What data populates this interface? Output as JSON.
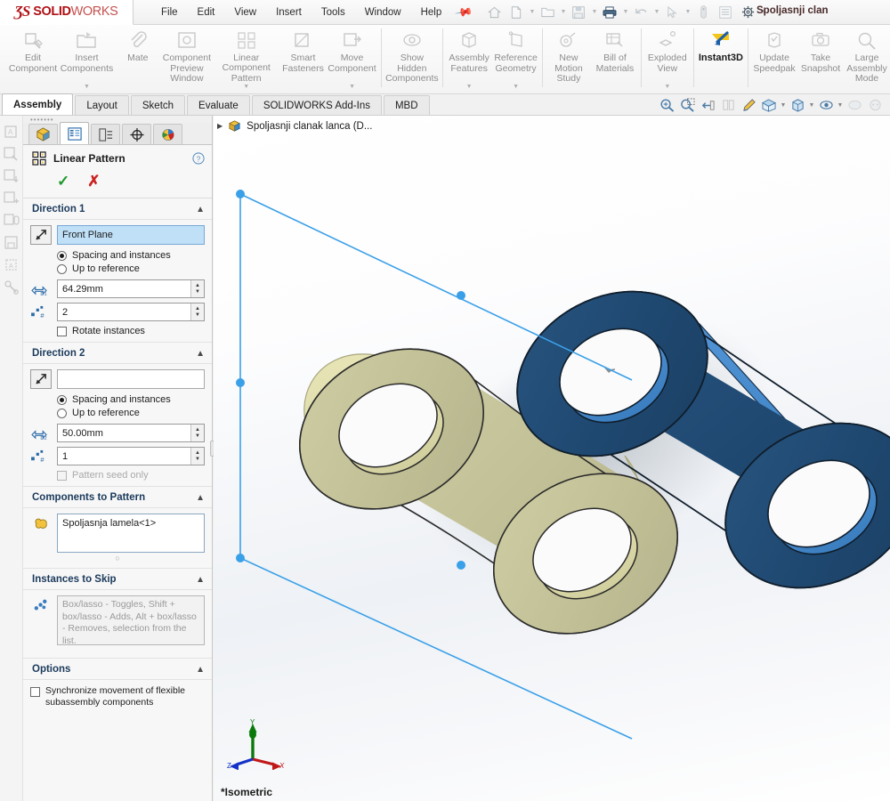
{
  "app": {
    "brand_ds": "ƷS",
    "brand_solid": "SOLID",
    "brand_works": "WORKS",
    "document_title": "Spoljasnji clan",
    "accent_blue": "#2878c8",
    "brand_red": "#b01116"
  },
  "menubar": {
    "items": [
      {
        "label": "File",
        "name": "menu-file"
      },
      {
        "label": "Edit",
        "name": "menu-edit"
      },
      {
        "label": "View",
        "name": "menu-view"
      },
      {
        "label": "Insert",
        "name": "menu-insert"
      },
      {
        "label": "Tools",
        "name": "menu-tools"
      },
      {
        "label": "Window",
        "name": "menu-window"
      },
      {
        "label": "Help",
        "name": "menu-help"
      }
    ],
    "pin_icon": "pushpin-icon"
  },
  "quick_access": {
    "items": [
      {
        "icon": "home-icon",
        "caret": false,
        "active": false
      },
      {
        "icon": "new-file-icon",
        "caret": true,
        "active": false
      },
      {
        "icon": "open-folder-icon",
        "caret": true,
        "active": false
      },
      {
        "icon": "save-icon",
        "caret": true,
        "active": false
      },
      {
        "icon": "print-icon",
        "caret": true,
        "active": true
      },
      {
        "icon": "undo-icon",
        "caret": true,
        "active": false
      },
      {
        "icon": "select-cursor-icon",
        "caret": true,
        "active": false
      },
      {
        "icon": "rebuild-icon",
        "caret": false,
        "active": false
      },
      {
        "icon": "options-list-icon",
        "caret": false,
        "active": false
      },
      {
        "icon": "gear-icon",
        "caret": true,
        "active": false
      }
    ]
  },
  "ribbon": {
    "buttons": [
      {
        "label": "Edit\nComponent",
        "icon": "edit-component-icon",
        "caret": false,
        "active": false,
        "sep_after": false
      },
      {
        "label": "Insert\nComponents",
        "icon": "insert-components-icon",
        "caret": true,
        "active": false,
        "sep_after": false
      },
      {
        "label": "Mate",
        "icon": "mate-paperclip-icon",
        "caret": false,
        "active": false,
        "sep_after": false
      },
      {
        "label": "Component\nPreview\nWindow",
        "icon": "component-preview-icon",
        "caret": false,
        "active": false,
        "sep_after": false
      },
      {
        "label": "Linear Component\nPattern",
        "icon": "linear-pattern-icon",
        "caret": true,
        "active": false,
        "sep_after": false
      },
      {
        "label": "Smart\nFasteners",
        "icon": "smart-fasteners-icon",
        "caret": false,
        "active": false,
        "sep_after": false
      },
      {
        "label": "Move\nComponent",
        "icon": "move-component-icon",
        "caret": true,
        "active": false,
        "sep_after": true
      },
      {
        "label": "Show\nHidden\nComponents",
        "icon": "show-hidden-icon",
        "caret": false,
        "active": false,
        "sep_after": true
      },
      {
        "label": "Assembly\nFeatures",
        "icon": "assembly-features-icon",
        "caret": true,
        "active": false,
        "sep_after": false
      },
      {
        "label": "Reference\nGeometry",
        "icon": "reference-geometry-icon",
        "caret": true,
        "active": false,
        "sep_after": true
      },
      {
        "label": "New\nMotion\nStudy",
        "icon": "new-motion-study-icon",
        "caret": false,
        "active": false,
        "sep_after": false
      },
      {
        "label": "Bill of\nMaterials",
        "icon": "bill-of-materials-icon",
        "caret": false,
        "active": false,
        "sep_after": true
      },
      {
        "label": "Exploded\nView",
        "icon": "exploded-view-icon",
        "caret": true,
        "active": false,
        "sep_after": true
      },
      {
        "label": "Instant3D",
        "icon": "instant3d-icon",
        "caret": false,
        "active": true,
        "sep_after": true
      },
      {
        "label": "Update\nSpeedpak",
        "icon": "update-speedpak-icon",
        "caret": false,
        "active": false,
        "sep_after": false
      },
      {
        "label": "Take\nSnapshot",
        "icon": "take-snapshot-icon",
        "caret": false,
        "active": false,
        "sep_after": false
      },
      {
        "label": "Large\nAssembly\nMode",
        "icon": "large-assembly-mode-icon",
        "caret": false,
        "active": false,
        "sep_after": false
      }
    ]
  },
  "command_tabs": {
    "items": [
      {
        "label": "Assembly",
        "selected": true
      },
      {
        "label": "Layout",
        "selected": false
      },
      {
        "label": "Sketch",
        "selected": false
      },
      {
        "label": "Evaluate",
        "selected": false
      },
      {
        "label": "SOLIDWORKS Add-Ins",
        "selected": false
      },
      {
        "label": "MBD",
        "selected": false
      }
    ]
  },
  "view_toolbar": {
    "items": [
      {
        "icon": "zoom-to-fit-icon",
        "caret": false,
        "dim": false
      },
      {
        "icon": "zoom-to-area-icon",
        "caret": false,
        "dim": false
      },
      {
        "icon": "previous-view-icon",
        "caret": false,
        "dim": false
      },
      {
        "icon": "section-view-icon",
        "caret": false,
        "dim": true
      },
      {
        "icon": "view-orientation-icon",
        "caret": false,
        "dim": false
      },
      {
        "icon": "display-style-icon",
        "caret": true,
        "dim": false
      },
      {
        "icon": "hide-show-items-icon",
        "caret": true,
        "dim": false
      },
      {
        "icon": "edit-appearance-icon",
        "caret": true,
        "dim": false
      },
      {
        "icon": "apply-scene-icon",
        "caret": false,
        "dim": true
      },
      {
        "icon": "view-settings-icon",
        "caret": false,
        "dim": true
      }
    ]
  },
  "left_rail": {
    "items": [
      {
        "icon": "note-icon"
      },
      {
        "icon": "edit-note-icon"
      },
      {
        "icon": "insert-note-icon"
      },
      {
        "icon": "add-note-icon"
      },
      {
        "icon": "note-balloon-icon"
      },
      {
        "icon": "save-note-icon"
      },
      {
        "icon": "note-pattern-icon"
      },
      {
        "icon": "measure-icon"
      }
    ]
  },
  "property_manager": {
    "tabs": [
      {
        "icon": "feature-manager-tree-icon",
        "selected": false
      },
      {
        "icon": "property-manager-icon",
        "selected": true
      },
      {
        "icon": "configuration-manager-icon",
        "selected": false
      },
      {
        "icon": "dimxpert-manager-icon",
        "selected": false
      },
      {
        "icon": "display-manager-icon",
        "selected": false
      }
    ],
    "title": "Linear Pattern",
    "title_icon": "linear-pattern-icon",
    "help_icon": "help-question-icon",
    "ok_icon": "green-check-icon",
    "cancel_icon": "red-x-icon",
    "direction1": {
      "header": "Direction 1",
      "reference_icon": "direction-arrow-icon",
      "reference_value": "Front Plane",
      "radio_spacing_label": "Spacing and instances",
      "radio_spacing_selected": true,
      "radio_uptoref_label": "Up to reference",
      "radio_uptoref_selected": false,
      "spacing_icon": "spacing-d1-icon",
      "spacing_value": "64.29mm",
      "instances_icon": "instances-count-icon",
      "instances_value": "2",
      "rotate_label": "Rotate instances",
      "rotate_checked": false
    },
    "direction2": {
      "header": "Direction 2",
      "reference_icon": "direction-arrow-icon",
      "reference_value": "",
      "radio_spacing_label": "Spacing and instances",
      "radio_spacing_selected": true,
      "radio_uptoref_label": "Up to reference",
      "radio_uptoref_selected": false,
      "spacing_icon": "spacing-d2-icon",
      "spacing_value": "50.00mm",
      "instances_icon": "instances-count-icon",
      "instances_value": "1",
      "seed_label": "Pattern seed only",
      "seed_checked": false,
      "seed_disabled": true
    },
    "components": {
      "header": "Components to Pattern",
      "icon": "components-to-pattern-icon",
      "value": "Spoljasnja lamela<1>"
    },
    "instances_to_skip": {
      "header": "Instances to Skip",
      "icon": "instances-to-skip-icon",
      "placeholder": "Box/lasso - Toggles, Shift + box/lasso - Adds, Alt + box/lasso - Removes, selection from the list."
    },
    "options": {
      "header": "Options",
      "sync_label": "Synchronize movement of flexible subassembly components",
      "sync_checked": false
    }
  },
  "graphics": {
    "feature_tree_label": "Spoljasnji clanak lanca  (D...",
    "feature_tree_icon": "assembly-cube-icon",
    "expand_icon": "chevron-right-icon",
    "view_orientation_label": "*Isometric",
    "triad_icon": "coordinate-triad-icon",
    "triad_axes": {
      "x": "X",
      "y": "Y",
      "z": "Z"
    },
    "model": {
      "seed_part_color": "#c8c79a",
      "pattern_part_color": "#1e4d7b",
      "pattern_part_side_color": "#3d85c8",
      "direction_line_color": "#3aa0e8"
    }
  }
}
